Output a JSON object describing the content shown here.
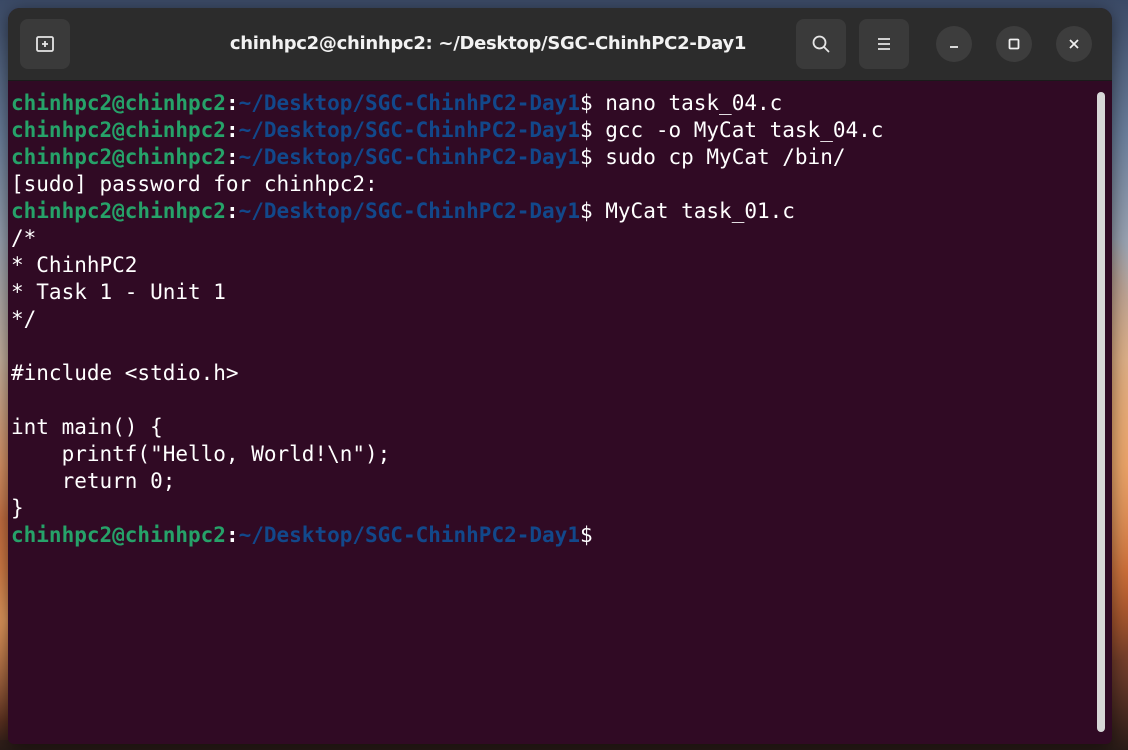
{
  "window": {
    "title": "chinhpc2@chinhpc2: ~/Desktop/SGC-ChinhPC2-Day1"
  },
  "colors": {
    "terminal_bg": "#300a24",
    "prompt_user": "#26a269",
    "prompt_path": "#12488b",
    "titlebar_bg": "#2c2c2c"
  },
  "icons": {
    "new_tab": "new-tab-icon",
    "search": "search-icon",
    "menu": "hamburger-menu-icon",
    "minimize": "minimize-icon",
    "maximize": "maximize-icon",
    "close": "close-icon"
  },
  "terminal": {
    "lines": [
      {
        "type": "prompt",
        "user": "chinhpc2@chinhpc2",
        "sep": ":",
        "path": "~/Desktop/SGC-ChinhPC2-Day1",
        "dollar": "$ ",
        "cmd": "nano task_04.c"
      },
      {
        "type": "prompt",
        "user": "chinhpc2@chinhpc2",
        "sep": ":",
        "path": "~/Desktop/SGC-ChinhPC2-Day1",
        "dollar": "$ ",
        "cmd": "gcc -o MyCat task_04.c"
      },
      {
        "type": "prompt",
        "user": "chinhpc2@chinhpc2",
        "sep": ":",
        "path": "~/Desktop/SGC-ChinhPC2-Day1",
        "dollar": "$ ",
        "cmd": "sudo cp MyCat /bin/"
      },
      {
        "type": "output",
        "text": "[sudo] password for chinhpc2:"
      },
      {
        "type": "prompt",
        "user": "chinhpc2@chinhpc2",
        "sep": ":",
        "path": "~/Desktop/SGC-ChinhPC2-Day1",
        "dollar": "$ ",
        "cmd": "MyCat task_01.c"
      },
      {
        "type": "output",
        "text": "/*"
      },
      {
        "type": "output",
        "text": "* ChinhPC2"
      },
      {
        "type": "output",
        "text": "* Task 1 - Unit 1"
      },
      {
        "type": "output",
        "text": "*/"
      },
      {
        "type": "output",
        "text": ""
      },
      {
        "type": "output",
        "text": "#include <stdio.h>"
      },
      {
        "type": "output",
        "text": ""
      },
      {
        "type": "output",
        "text": "int main() {"
      },
      {
        "type": "output",
        "text": "    printf(\"Hello, World!\\n\");"
      },
      {
        "type": "output",
        "text": "    return 0;"
      },
      {
        "type": "output",
        "text": "}"
      },
      {
        "type": "prompt",
        "user": "chinhpc2@chinhpc2",
        "sep": ":",
        "path": "~/Desktop/SGC-ChinhPC2-Day1",
        "dollar": "$",
        "cmd": ""
      }
    ]
  }
}
